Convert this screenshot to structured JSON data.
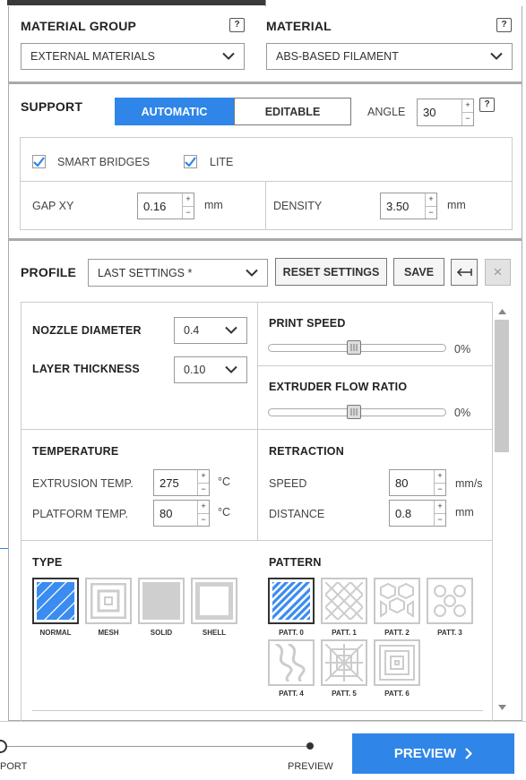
{
  "material": {
    "group_label": "MATERIAL GROUP",
    "group_value": "EXTERNAL MATERIALS",
    "material_label": "MATERIAL",
    "material_value": "ABS-BASED FILAMENT",
    "help": "?"
  },
  "support": {
    "label": "SUPPORT",
    "automatic": "AUTOMATIC",
    "editable": "EDITABLE",
    "angle_label": "ANGLE",
    "angle_value": "30",
    "smart_bridges": "SMART BRIDGES",
    "lite": "LITE",
    "gap_label": "GAP XY",
    "gap_value": "0.16",
    "gap_unit": "mm",
    "density_label": "DENSITY",
    "density_value": "3.50",
    "density_unit": "mm"
  },
  "profile": {
    "label": "PROFILE",
    "value": "LAST SETTINGS *",
    "reset": "RESET SETTINGS",
    "save": "SAVE",
    "close": "×"
  },
  "settings": {
    "nozzle_label": "NOZZLE DIAMETER",
    "nozzle_value": "0.4",
    "layer_label": "LAYER THICKNESS",
    "layer_value": "0.10",
    "print_speed_label": "PRINT SPEED",
    "print_speed_value": "0%",
    "print_speed_level": 0.5,
    "flow_label": "EXTRUDER FLOW RATIO",
    "flow_value": "0%",
    "flow_level": 0.5,
    "temperature_label": "TEMPERATURE",
    "extrusion_label": "EXTRUSION TEMP.",
    "extrusion_value": "275",
    "platform_label": "PLATFORM TEMP.",
    "platform_value": "80",
    "temp_unit": "°C",
    "retraction_label": "RETRACTION",
    "speed_label": "SPEED",
    "speed_value": "80",
    "speed_unit": "mm/s",
    "distance_label": "DISTANCE",
    "distance_value": "0.8",
    "distance_unit": "mm"
  },
  "type": {
    "label": "TYPE",
    "items": [
      "NORMAL",
      "MESH",
      "SOLID",
      "SHELL"
    ]
  },
  "pattern": {
    "label": "PATTERN",
    "items": [
      "PATT. 0",
      "PATT. 1",
      "PATT. 2",
      "PATT. 3",
      "PATT. 4",
      "PATT. 5",
      "PATT. 6"
    ]
  },
  "footer": {
    "step_left": "PORT",
    "step_right": "PREVIEW",
    "preview_button": "PREVIEW"
  },
  "colors": {
    "accent": "#2f86e8",
    "selected_tile": "#3a8cf0"
  }
}
